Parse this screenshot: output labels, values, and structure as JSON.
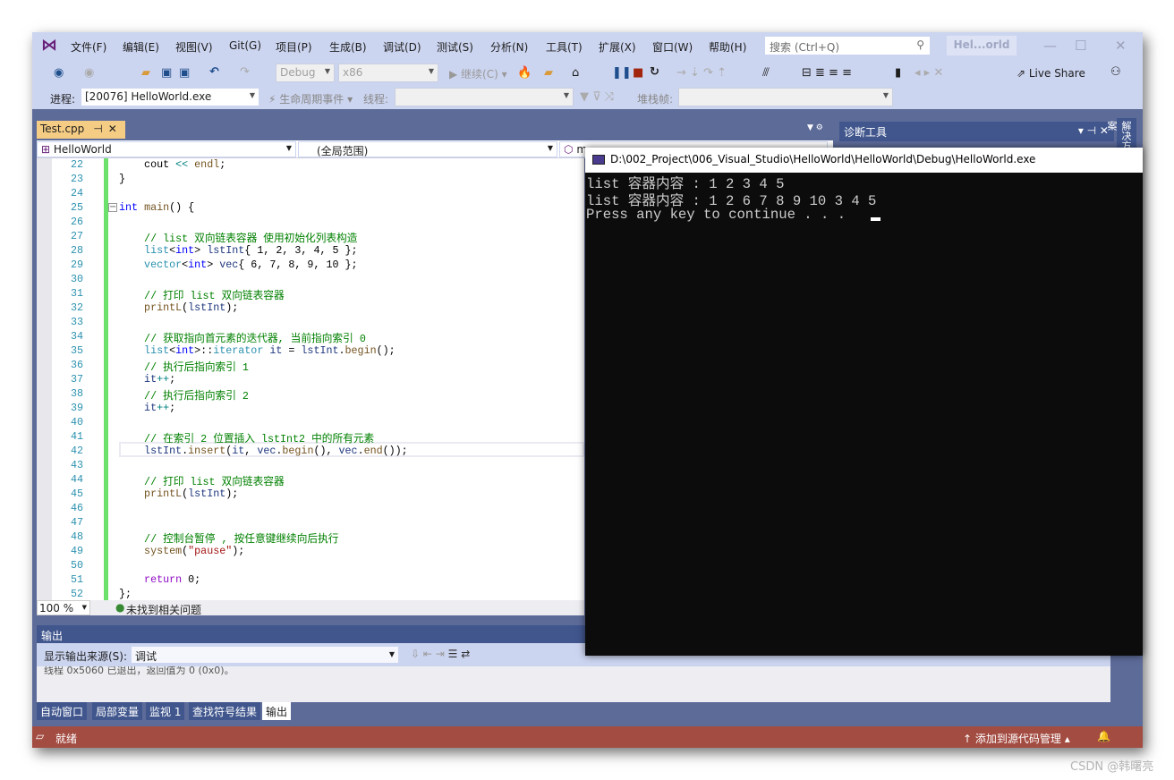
{
  "menu": {
    "items": [
      "文件(F)",
      "编辑(E)",
      "视图(V)",
      "Git(G)",
      "项目(P)",
      "生成(B)",
      "调试(D)",
      "测试(S)",
      "分析(N)",
      "工具(T)",
      "扩展(X)",
      "窗口(W)",
      "帮助(H)"
    ],
    "search_placeholder": "搜索 (Ctrl+Q)",
    "title": "Hel...orld"
  },
  "toolbar": {
    "config": "Debug",
    "platform": "x86",
    "continue": "继续(C)",
    "live_share": "Live Share",
    "process_label": "进程:",
    "process_value": "[20076] HelloWorld.exe",
    "lifecycle": "生命周期事件",
    "thread_label": "线程:",
    "stack_label": "堆栈帧:"
  },
  "editor": {
    "tab": "Test.cpp",
    "nav_project": "HelloWorld",
    "nav_scope": "(全局范围)",
    "nav_member": "m",
    "zoom": "100 %",
    "issues": "未找到相关问题",
    "lines": [
      {
        "n": "22",
        "t": [
          [
            "    cout ",
            "pl"
          ],
          [
            "<<",
            "op"
          ],
          [
            " endl",
            "fn"
          ],
          [
            ";",
            "pl"
          ]
        ]
      },
      {
        "n": "23",
        "t": [
          [
            "}",
            "pl"
          ]
        ]
      },
      {
        "n": "24",
        "t": []
      },
      {
        "n": "25",
        "t": [
          [
            "int",
            "kw"
          ],
          [
            " ",
            "pl"
          ],
          [
            "main",
            "fn"
          ],
          [
            "() {",
            "pl"
          ]
        ]
      },
      {
        "n": "26",
        "t": []
      },
      {
        "n": "27",
        "t": [
          [
            "    // list 双向链表容器 使用初始化列表构造",
            "cm"
          ]
        ]
      },
      {
        "n": "28",
        "t": [
          [
            "    list",
            "ty"
          ],
          [
            "<",
            "pl"
          ],
          [
            "int",
            "kw"
          ],
          [
            "> ",
            "pl"
          ],
          [
            "lstInt",
            "va"
          ],
          [
            "{ 1, 2, 3, 4, 5 };",
            "pl"
          ]
        ]
      },
      {
        "n": "29",
        "t": [
          [
            "    vector",
            "ty"
          ],
          [
            "<",
            "pl"
          ],
          [
            "int",
            "kw"
          ],
          [
            "> ",
            "pl"
          ],
          [
            "vec",
            "va"
          ],
          [
            "{ 6, 7, 8, 9, 10 };",
            "pl"
          ]
        ]
      },
      {
        "n": "30",
        "t": []
      },
      {
        "n": "31",
        "t": [
          [
            "    // 打印 list 双向链表容器",
            "cm"
          ]
        ]
      },
      {
        "n": "32",
        "t": [
          [
            "    printL",
            "fn"
          ],
          [
            "(",
            "pl"
          ],
          [
            "lstInt",
            "va"
          ],
          [
            ");",
            "pl"
          ]
        ]
      },
      {
        "n": "33",
        "t": []
      },
      {
        "n": "34",
        "t": [
          [
            "    // 获取指向首元素的迭代器, 当前指向索引 0",
            "cm"
          ]
        ]
      },
      {
        "n": "35",
        "t": [
          [
            "    list",
            "ty"
          ],
          [
            "<",
            "pl"
          ],
          [
            "int",
            "kw"
          ],
          [
            ">::",
            "pl"
          ],
          [
            "iterator",
            "ty"
          ],
          [
            " ",
            "pl"
          ],
          [
            "it",
            "va"
          ],
          [
            " = ",
            "pl"
          ],
          [
            "lstInt",
            "va"
          ],
          [
            ".",
            "pl"
          ],
          [
            "begin",
            "fn"
          ],
          [
            "();",
            "pl"
          ]
        ]
      },
      {
        "n": "36",
        "t": [
          [
            "    // 执行后指向索引 1",
            "cm"
          ]
        ]
      },
      {
        "n": "37",
        "t": [
          [
            "    it",
            "va"
          ],
          [
            "++",
            "op"
          ],
          [
            ";",
            "pl"
          ]
        ]
      },
      {
        "n": "38",
        "t": [
          [
            "    // 执行后指向索引 2",
            "cm"
          ]
        ]
      },
      {
        "n": "39",
        "t": [
          [
            "    it",
            "va"
          ],
          [
            "++",
            "op"
          ],
          [
            ";",
            "pl"
          ]
        ]
      },
      {
        "n": "40",
        "t": []
      },
      {
        "n": "41",
        "t": [
          [
            "    // 在索引 2 位置插入 lstInt2 中的所有元素",
            "cm"
          ]
        ]
      },
      {
        "n": "42",
        "t": [
          [
            "    lstInt",
            "va"
          ],
          [
            ".",
            "pl"
          ],
          [
            "insert",
            "fn"
          ],
          [
            "(",
            "pl"
          ],
          [
            "it",
            "va"
          ],
          [
            ", ",
            "pl"
          ],
          [
            "vec",
            "va"
          ],
          [
            ".",
            "pl"
          ],
          [
            "begin",
            "fn"
          ],
          [
            "(), ",
            "pl"
          ],
          [
            "vec",
            "va"
          ],
          [
            ".",
            "pl"
          ],
          [
            "end",
            "fn"
          ],
          [
            "());",
            "pl"
          ]
        ]
      },
      {
        "n": "43",
        "t": []
      },
      {
        "n": "44",
        "t": [
          [
            "    // 打印 list 双向链表容器",
            "cm"
          ]
        ]
      },
      {
        "n": "45",
        "t": [
          [
            "    printL",
            "fn"
          ],
          [
            "(",
            "pl"
          ],
          [
            "lstInt",
            "va"
          ],
          [
            ");",
            "pl"
          ]
        ]
      },
      {
        "n": "46",
        "t": []
      },
      {
        "n": "47",
        "t": []
      },
      {
        "n": "48",
        "t": [
          [
            "    // 控制台暂停 , 按任意键继续向后执行",
            "cm"
          ]
        ]
      },
      {
        "n": "49",
        "t": [
          [
            "    system",
            "fn"
          ],
          [
            "(",
            "pl"
          ],
          [
            "\"pause\"",
            "st"
          ],
          [
            ");",
            "pl"
          ]
        ]
      },
      {
        "n": "50",
        "t": []
      },
      {
        "n": "51",
        "t": [
          [
            "    return",
            "ctl"
          ],
          [
            " 0;",
            "pl"
          ]
        ]
      },
      {
        "n": "52",
        "t": [
          [
            "};",
            "pl"
          ]
        ]
      }
    ]
  },
  "diagnostics": {
    "title": "诊断工具"
  },
  "side_tab": "解决方案",
  "output": {
    "title": "输出",
    "source_label": "显示输出来源(S):",
    "source_value": "调试",
    "text": "线程 0x5060 已退出，返回值为 0 (0x0)。"
  },
  "bottom_tabs": [
    "自动窗口",
    "局部变量",
    "监视 1",
    "查找符号结果",
    "输出"
  ],
  "status": {
    "ready": "就绪",
    "source_control": "添加到源代码管理"
  },
  "console": {
    "title": "D:\\002_Project\\006_Visual_Studio\\HelloWorld\\HelloWorld\\Debug\\HelloWorld.exe",
    "lines": [
      "list 容器内容 : 1 2 3 4 5",
      "list 容器内容 : 1 2 6 7 8 9 10 3 4 5",
      "Press any key to continue . . . "
    ]
  },
  "watermark": "CSDN @韩曙亮",
  "colors": {
    "accent": "#40568d",
    "status_bar": "#a34c42",
    "tab_active": "#f5cc84",
    "change_bar": "#6ce26c"
  }
}
